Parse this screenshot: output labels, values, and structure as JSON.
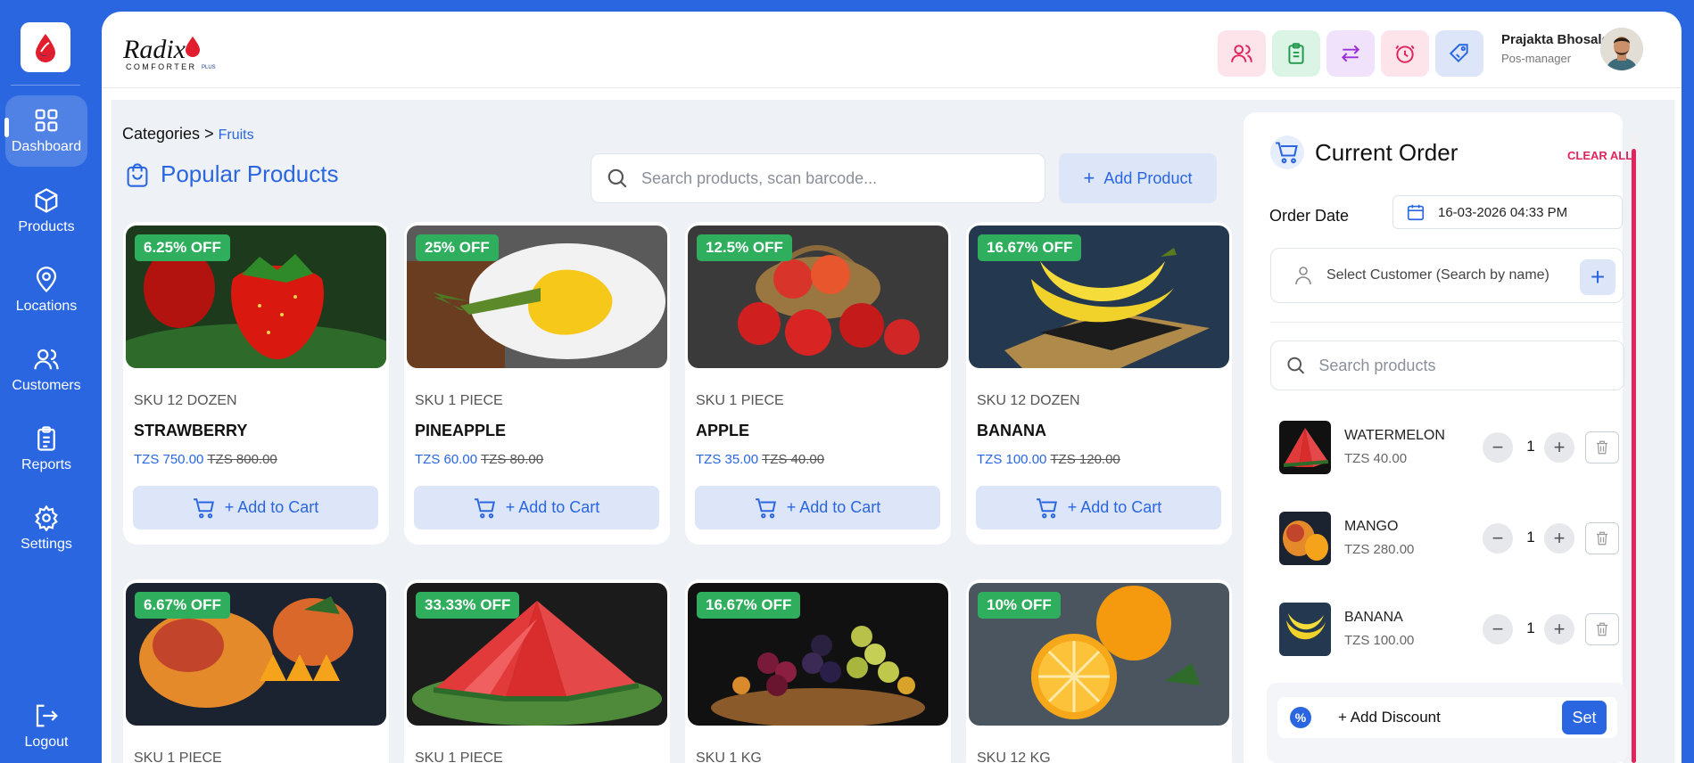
{
  "sidebar": {
    "items": [
      {
        "label": "Dashboard",
        "icon": "dashboard-icon"
      },
      {
        "label": "Products",
        "icon": "cube-icon"
      },
      {
        "label": "Locations",
        "icon": "location-pin-icon"
      },
      {
        "label": "Customers",
        "icon": "users-icon"
      },
      {
        "label": "Reports",
        "icon": "clipboard-icon"
      },
      {
        "label": "Settings",
        "icon": "gear-icon"
      }
    ],
    "logout": "Logout"
  },
  "header": {
    "brand": "Radix",
    "brand_sub": "COMFORTER",
    "brand_tag": "PLUS",
    "user_name": "Prajakta Bhosale",
    "user_role": "Pos-manager",
    "icons": [
      "customers-icon",
      "clipboard-icon",
      "transfer-icon",
      "time-icon",
      "tag-icon"
    ]
  },
  "breadcrumb": {
    "root": "Categories",
    "sep": ">",
    "current": "Fruits"
  },
  "section_title": "Popular Products",
  "search": {
    "placeholder": "Search products, scan barcode..."
  },
  "add_product_label": "Add Product",
  "add_to_cart_label": "+ Add to Cart",
  "products": [
    {
      "badge": "6.25% OFF",
      "sku": "SKU 12 DOZEN",
      "name": "STRAWBERRY",
      "price": "TZS 750.00",
      "old_price": "TZS 800.00"
    },
    {
      "badge": "25% OFF",
      "sku": "SKU 1 PIECE",
      "name": "PINEAPPLE",
      "price": "TZS 60.00",
      "old_price": "TZS 80.00"
    },
    {
      "badge": "12.5% OFF",
      "sku": "SKU 1 PIECE",
      "name": "APPLE",
      "price": "TZS 35.00",
      "old_price": "TZS 40.00"
    },
    {
      "badge": "16.67% OFF",
      "sku": "SKU 12 DOZEN",
      "name": "BANANA",
      "price": "TZS 100.00",
      "old_price": "TZS 120.00"
    },
    {
      "badge": "6.67% OFF",
      "sku": "SKU 1 PIECE"
    },
    {
      "badge": "33.33% OFF",
      "sku": "SKU 1 PIECE"
    },
    {
      "badge": "16.67% OFF",
      "sku": "SKU 1 KG"
    },
    {
      "badge": "10% OFF",
      "sku": "SKU 12 KG"
    }
  ],
  "order": {
    "title": "Current Order",
    "clear_all": "CLEAR ALL",
    "date_label": "Order Date",
    "date_value": "16-03-2026 04:33  PM",
    "customer_placeholder": "Select Customer (Search by name)",
    "search_placeholder": "Search products",
    "items": [
      {
        "name": "WATERMELON",
        "price": "TZS 40.00",
        "qty": "1"
      },
      {
        "name": "MANGO",
        "price": "TZS 280.00",
        "qty": "1"
      },
      {
        "name": "BANANA",
        "price": "TZS 100.00",
        "qty": "1"
      }
    ],
    "discount_label": "+ Add Discount",
    "discount_icon": "%",
    "set_label": "Set"
  },
  "colors": {
    "primary": "#2a66e0",
    "badge": "#2fae5e",
    "danger": "#e0245e"
  }
}
